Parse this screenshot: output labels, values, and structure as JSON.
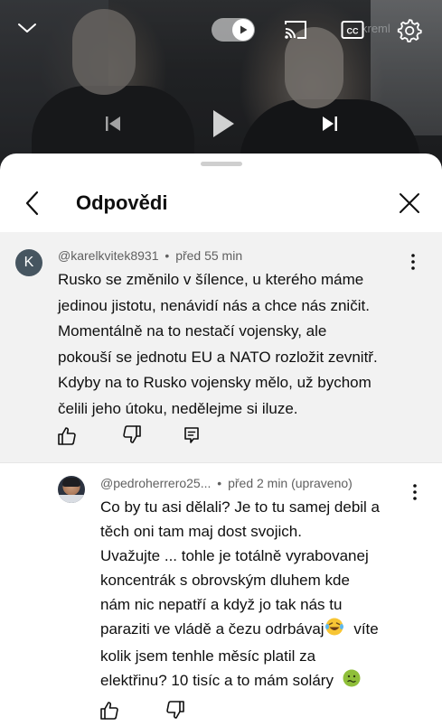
{
  "player": {
    "icons": [
      "chevron-down-icon",
      "autoplay-toggle-icon",
      "cast-icon",
      "closed-captions-icon",
      "settings-gear-icon",
      "previous-track-icon",
      "play-icon",
      "next-track-icon"
    ],
    "cc_label": "CC",
    "sign_text": "kreml"
  },
  "sheet": {
    "title": "Odpovědi"
  },
  "parent_comment": {
    "avatar_letter": "K",
    "author": "@karelkvitek8931",
    "time": "před 55 min",
    "separator": "•",
    "lines": [
      "Rusko se změnilo v šílence, u kterého máme",
      "jedinou jistotu, nenávidí nás a chce nás zničit.",
      "Momentálně na to nestačí vojensky, ale",
      "pokouší se jednotu EU a NATO rozložit zevnitř.",
      "Kdyby na to Rusko vojensky mělo, už bychom",
      "čelili jeho útoku, nedělejme si iluze."
    ]
  },
  "reply": {
    "author": "@pedroherrero25...",
    "time": "před 2 min (upraveno)",
    "separator": "•",
    "lines": [
      "Co by tu asi dělali? Je to tu samej debil a",
      "těch oni tam maj dost svojich.",
      "Uvažujte ... tohle je totálně vyrabovanej",
      "koncentrák s obrovským dluhem kde",
      "nám nic nepatří a když jo tak nás tu",
      "paraziti ve vládě a čezu odrbávaj",
      "víte",
      "kolik jsem tenhle měsíc platil za",
      "elektřinu? 10 tisíc a to mám soláry"
    ]
  },
  "colors": {
    "accent_text": "#0f0f0f",
    "meta": "#606060",
    "parent_bg": "#f2f2f2",
    "avatar_k": "#465560"
  }
}
